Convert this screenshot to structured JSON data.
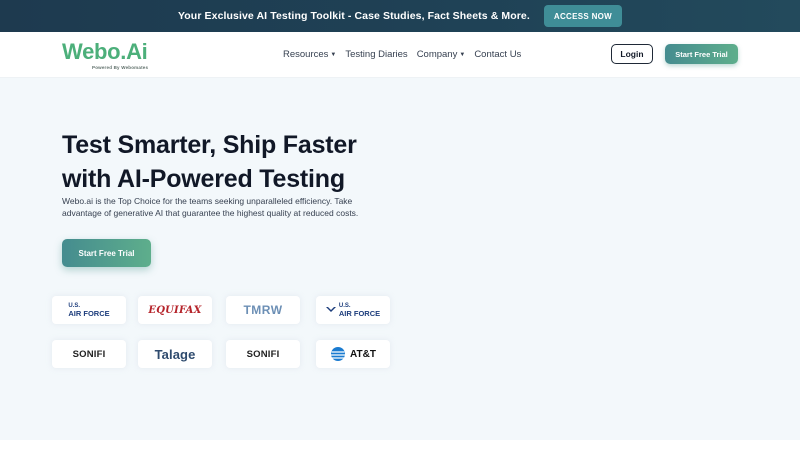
{
  "announcement": {
    "text": "Your Exclusive AI Testing Toolkit - Case Studies, Fact Sheets & More.",
    "button": "ACCESS NOW"
  },
  "header": {
    "logo_main": "Webo.Ai",
    "logo_sub": "Powered By Webomates",
    "nav": [
      {
        "label": "Resources",
        "has_dropdown": true
      },
      {
        "label": "Testing Diaries",
        "has_dropdown": false
      },
      {
        "label": "Company",
        "has_dropdown": true
      },
      {
        "label": "Contact Us",
        "has_dropdown": false
      }
    ],
    "login": "Login",
    "trial": "Start Free Trial"
  },
  "hero": {
    "title": "Test Smarter, Ship Faster with AI-Powered Testing",
    "subtitle": "Webo.ai is the Top Choice for the teams seeking unparalleled efficiency. Take advantage of generative AI that guarantee the highest quality at reduced costs.",
    "cta": "Start Free Trial"
  },
  "clients": {
    "row1": [
      {
        "name": "us-air-force",
        "line1": "U.S.",
        "line2": "AIR FORCE"
      },
      {
        "name": "equifax",
        "text": "EQUIFAX"
      },
      {
        "name": "tmrw",
        "text": "TMRW"
      },
      {
        "name": "us-air-force-wing",
        "line1": "U.S.",
        "line2": "AIR FORCE"
      }
    ],
    "row2": [
      {
        "name": "sonifi",
        "text": "SONIFI"
      },
      {
        "name": "talage",
        "text": "Talage"
      },
      {
        "name": "sonifi-2",
        "text": "SONIFI"
      },
      {
        "name": "att",
        "text": "AT&T"
      }
    ]
  },
  "colors": {
    "accent": "#4caf7a",
    "button_gradient_start": "#458c8f",
    "button_gradient_end": "#5eae8c",
    "announce_bg": "#1f4256",
    "hero_bg": "#f3f8fb"
  }
}
